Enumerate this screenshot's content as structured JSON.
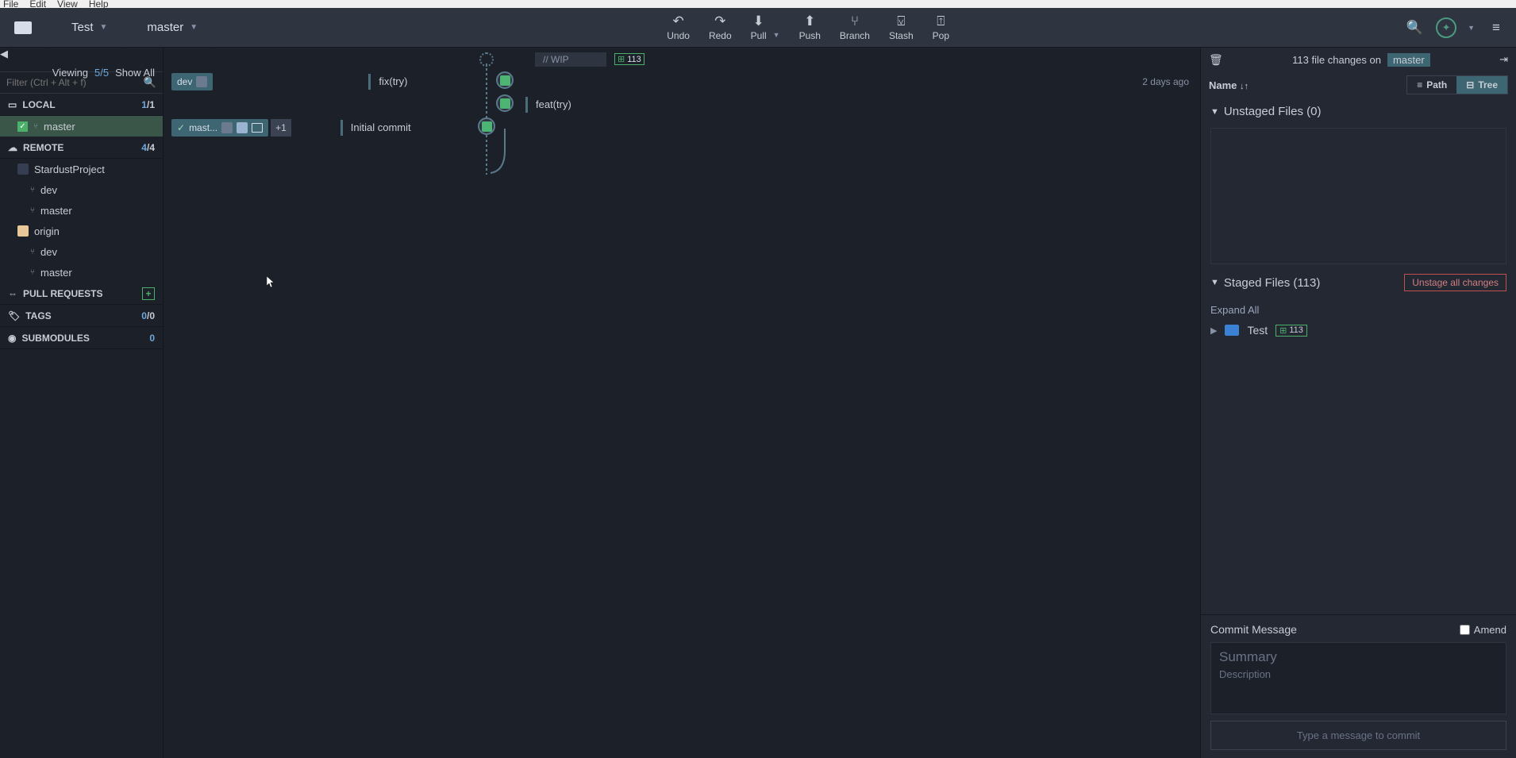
{
  "menu": {
    "file": "File",
    "edit": "Edit",
    "view": "View",
    "help": "Help"
  },
  "crumbs": {
    "repo": "Test",
    "branch": "master"
  },
  "toolbar": {
    "undo": "Undo",
    "redo": "Redo",
    "pull": "Pull",
    "push": "Push",
    "branch": "Branch",
    "stash": "Stash",
    "pop": "Pop"
  },
  "leftbar": {
    "viewing": "Viewing",
    "view_count": "5/5",
    "show_all": "Show All",
    "filter_ph": "Filter (Ctrl + Alt + f)",
    "local": {
      "title": "LOCAL",
      "count_a": "1",
      "count_b": "/1",
      "items": [
        "master"
      ]
    },
    "remote": {
      "title": "REMOTE",
      "count_a": "4",
      "count_b": "/4",
      "remotes": [
        {
          "name": "StardustProject",
          "branches": [
            "dev",
            "master"
          ]
        },
        {
          "name": "origin",
          "branches": [
            "dev",
            "master"
          ]
        }
      ]
    },
    "pr": {
      "title": "PULL REQUESTS"
    },
    "tags": {
      "title": "TAGS",
      "count_a": "0",
      "count_b": "/0"
    },
    "sub": {
      "title": "SUBMODULES",
      "count": "0"
    }
  },
  "graph": {
    "wip": "//  WIP",
    "wip_count": "113",
    "rows": [
      {
        "tag": "dev",
        "msg": "fix(try)",
        "time": "2 days ago"
      },
      {
        "msg": "feat(try)"
      },
      {
        "tag": "mast...",
        "extra": "+1",
        "msg": "Initial commit"
      }
    ]
  },
  "right": {
    "changes_text_a": "113 file changes on",
    "changes_branch": "master",
    "name": "Name",
    "path": "Path",
    "tree": "Tree",
    "unstaged": "Unstaged Files (0)",
    "staged": "Staged Files (113)",
    "unstage_btn": "Unstage all changes",
    "expand": "Expand All",
    "file": {
      "name": "Test",
      "count": "113"
    },
    "commit_title": "Commit Message",
    "amend": "Amend",
    "summary_ph": "Summary",
    "desc_ph": "Description",
    "commit_btn": "Type a message to commit"
  }
}
